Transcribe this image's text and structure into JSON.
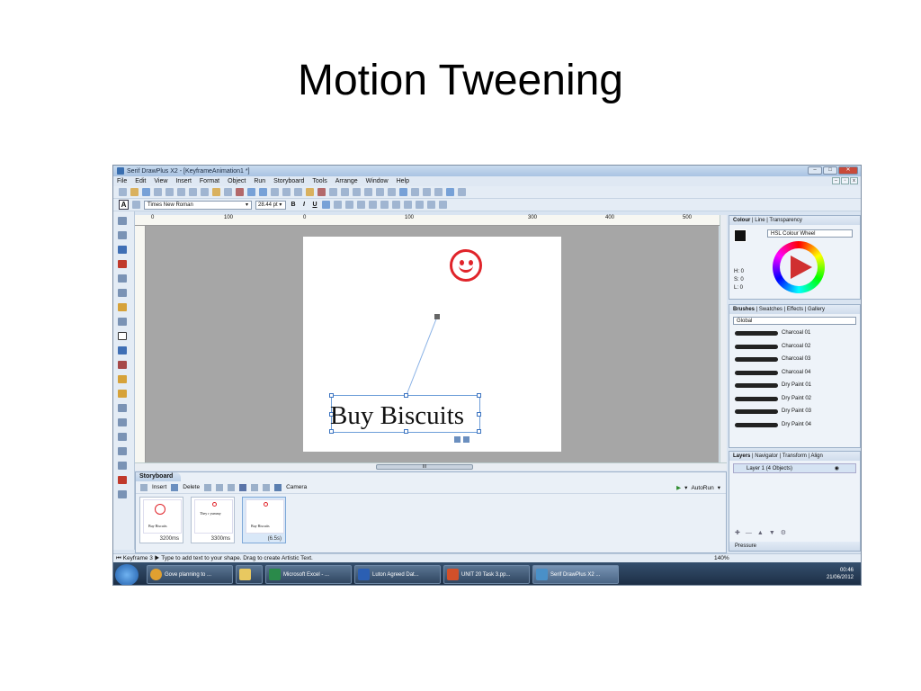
{
  "slide": {
    "title": "Motion Tweening"
  },
  "app": {
    "title": "Serif DrawPlus X2 - [KeyframeAnimation1 *]",
    "menu": [
      "File",
      "Edit",
      "View",
      "Insert",
      "Format",
      "Object",
      "Run",
      "Storyboard",
      "Tools",
      "Arrange",
      "Window",
      "Help"
    ],
    "font_name": "Times New Roman",
    "font_size": "28.44 pt",
    "format_buttons": [
      "B",
      "I",
      "U"
    ]
  },
  "ruler": {
    "ticks": [
      "0",
      "100",
      "0",
      "100",
      "300",
      "400",
      "500"
    ]
  },
  "canvas": {
    "text_object": "Buy Biscuits"
  },
  "storyboard": {
    "title": "Storyboard",
    "insert_label": "Insert",
    "delete_label": "Delete",
    "camera_label": "Camera",
    "autorun_label": "AutoRun",
    "frames": [
      {
        "caption": "Buy Biscuits",
        "duration": "3200ms"
      },
      {
        "caption": "They r yummy",
        "duration": "3300ms"
      },
      {
        "caption": "Buy Biscuits",
        "duration": "(6.5s)"
      }
    ]
  },
  "colour_panel": {
    "tabs": [
      "Colour",
      "Line",
      "Transparency"
    ],
    "model": "HSL Colour Wheel",
    "h": "H: 0",
    "s": "S: 0",
    "l": "L: 0"
  },
  "brushes_panel": {
    "tabs": [
      "Brushes",
      "Swatches",
      "Effects",
      "Gallery"
    ],
    "category": "Global",
    "items": [
      "Charcoal 01",
      "Charcoal 02",
      "Charcoal 03",
      "Charcoal 04",
      "Dry Paint 01",
      "Dry Paint 02",
      "Dry Paint 03",
      "Dry Paint 04"
    ]
  },
  "layers_panel": {
    "tabs": [
      "Layers",
      "Navigator",
      "Transform",
      "Align"
    ],
    "layer_name": "Layer 1",
    "layer_info": "(4 Objects)",
    "footer": "Pressure"
  },
  "status": {
    "keyframe": "Keyframe 3",
    "hint": "Type to add text to your shape. Drag to create Artistic Text.",
    "zoom": "140%"
  },
  "taskbar": {
    "items": [
      "Gove planning to ...",
      "Microsoft Excel - ...",
      "Luton Agreed Dat...",
      "UNIT 20 Task 3.pp...",
      "Serif DrawPlus X2 ..."
    ],
    "time": "00:46",
    "date": "21/06/2012"
  },
  "colors": {
    "accent": "#e0242a",
    "taskbar": "#1b2c42",
    "window": "#d9e4f1"
  }
}
